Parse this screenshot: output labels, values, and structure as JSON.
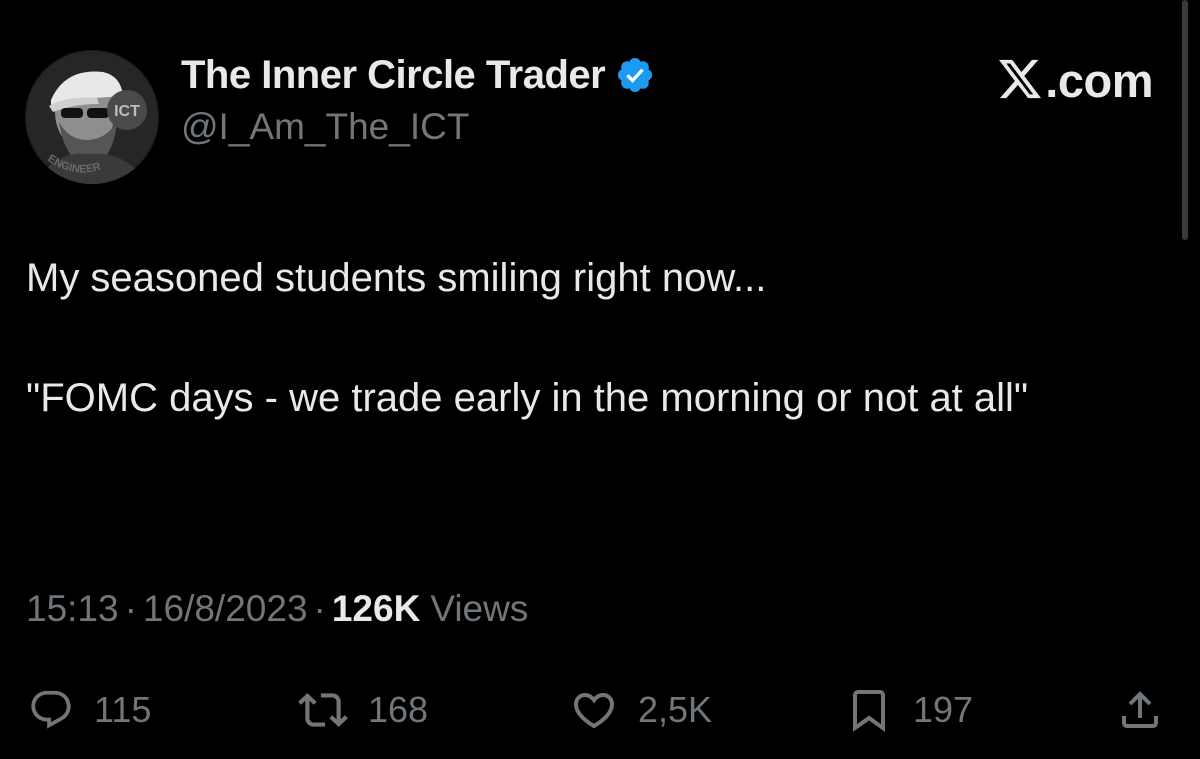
{
  "author": {
    "display_name": "The Inner Circle Trader",
    "handle": "@I_Am_The_ICT",
    "verified": true,
    "avatar_text": "ENGINEER"
  },
  "brand": {
    "logo_text": ".com"
  },
  "tweet": {
    "line1": "My seasoned students smiling right now...",
    "line2": "\"FOMC days - we trade early in the morning or not at all\""
  },
  "meta": {
    "time": "15:13",
    "separator": "·",
    "date": "16/8/2023",
    "views_count": "126K",
    "views_label": "Views"
  },
  "actions": {
    "replies": "115",
    "reposts": "168",
    "likes": "2,5K",
    "bookmarks": "197"
  },
  "colors": {
    "background": "#000000",
    "text": "#e7e9ea",
    "secondary": "#71767b",
    "verified": "#1d9bf0"
  },
  "icons": [
    "verified-badge-icon",
    "x-logo-icon",
    "reply-icon",
    "repost-icon",
    "like-icon",
    "bookmark-icon",
    "share-icon"
  ]
}
